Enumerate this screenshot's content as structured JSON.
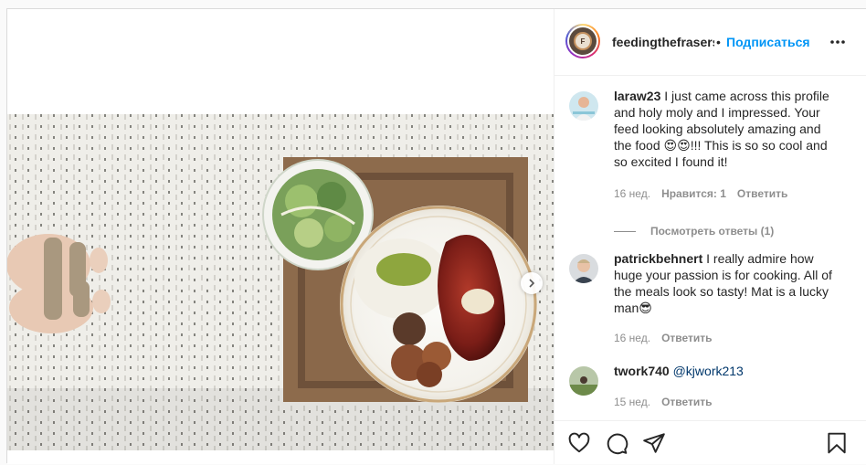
{
  "post": {
    "owner": "feedingthefrasers",
    "follow_label": "Подписаться",
    "separator": "•"
  },
  "comments": [
    {
      "username": "laraw23",
      "text_before": " I just came across this profile and holy moly and I impressed. Your feed looking absolutely amazing and the food ",
      "emoji": "😍😍",
      "text_after": "!!! This is so so cool and so excited I found it!",
      "time": "16 нед.",
      "likes": "Нравится: 1",
      "reply_label": "Ответить",
      "view_replies": "Посмотреть ответы (1)"
    },
    {
      "username": "patrickbehnert",
      "text_before": " I really admire how huge your passion is for cooking. All of the meals look so tasty! Mat is a lucky man",
      "emoji": "😎",
      "time": "16 нед.",
      "reply_label": "Ответить"
    },
    {
      "username": "twork740",
      "mention": "@kjwork213",
      "time": "15 нед.",
      "reply_label": "Ответить"
    }
  ],
  "icons": {
    "like": "heart-icon",
    "comment": "comment-icon",
    "share": "paper-plane-icon",
    "save": "bookmark-icon",
    "more": "more-options-icon",
    "next": "chevron-right-icon"
  },
  "colors": {
    "link_blue": "#0095f6",
    "mention_blue": "#00376b",
    "secondary_text": "#8e8e8e",
    "border": "#dbdbdb"
  }
}
